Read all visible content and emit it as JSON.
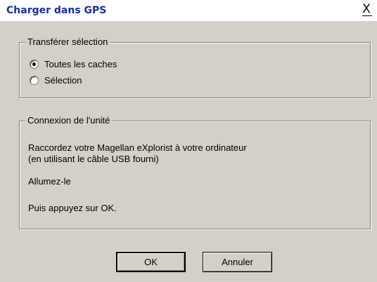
{
  "window": {
    "title": "Charger dans GPS",
    "close_label": "X"
  },
  "transfer_group": {
    "legend": "Transférer sélection",
    "options": [
      {
        "label": "Toutes les caches",
        "selected": true
      },
      {
        "label": "Sélection",
        "selected": false
      }
    ]
  },
  "connection_group": {
    "legend": "Connexion de l'unité",
    "lines": [
      "Raccordez votre Magellan eXplorist à votre ordinateur",
      "(en utilisant le câble USB fourni)",
      "Allumez-le",
      "Puis appuyez sur OK."
    ]
  },
  "buttons": {
    "ok_label": "OK",
    "cancel_label": "Annuler"
  },
  "colors": {
    "dialog_bg": "#d4d0c8",
    "title_text": "#1b2e97"
  }
}
